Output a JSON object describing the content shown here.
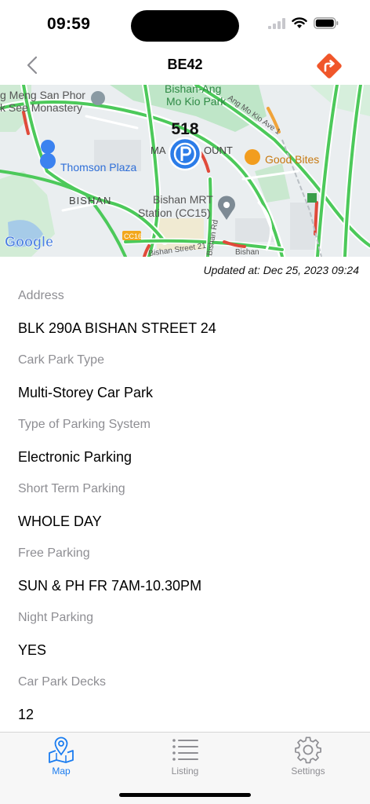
{
  "status_bar": {
    "time": "09:59"
  },
  "nav": {
    "title": "BE42"
  },
  "map": {
    "marker_label": "518",
    "places": {
      "meng_san_1": "g Meng San Phor",
      "meng_san_2": "k See Monastery",
      "bishan_ang_1": "Bishan-Ang",
      "bishan_ang_2": "Mo Kio Park",
      "ang_mo_kio_ave": "Ang Mo Kio Ave 1",
      "thomson_plaza": "Thomson Plaza",
      "mall_partial_1": "MA",
      "mall_partial_2": "OUNT",
      "good_bites": "Good Bites",
      "bishan": "BISHAN",
      "mrt_1": "Bishan MRT",
      "mrt_2": "Station (CC15)",
      "cc16": "CC16",
      "bishan_st21": "Bishan Street 21",
      "bishan_rd": "Bishan Rd",
      "bishan_trail": "Bishan",
      "google": "Google"
    }
  },
  "updated_at": "Updated at: Dec 25, 2023 09:24",
  "details": [
    {
      "label": "Address",
      "value": "BLK 290A BISHAN STREET 24"
    },
    {
      "label": "Cark Park Type",
      "value": "Multi-Storey Car Park"
    },
    {
      "label": "Type of Parking System",
      "value": "Electronic Parking"
    },
    {
      "label": "Short Term Parking",
      "value": "WHOLE DAY"
    },
    {
      "label": "Free Parking",
      "value": "SUN & PH FR 7AM-10.30PM"
    },
    {
      "label": "Night Parking",
      "value": "YES"
    },
    {
      "label": "Car Park Decks",
      "value": "12"
    }
  ],
  "tabs": [
    {
      "label": "Map",
      "icon": "map-pin-icon",
      "active": true
    },
    {
      "label": "Listing",
      "icon": "list-icon",
      "active": false
    },
    {
      "label": "Settings",
      "icon": "gear-icon",
      "active": false
    }
  ],
  "colors": {
    "accent": "#1a7cf0",
    "directions": "#f0562a",
    "label_gray": "#8e8e93"
  }
}
